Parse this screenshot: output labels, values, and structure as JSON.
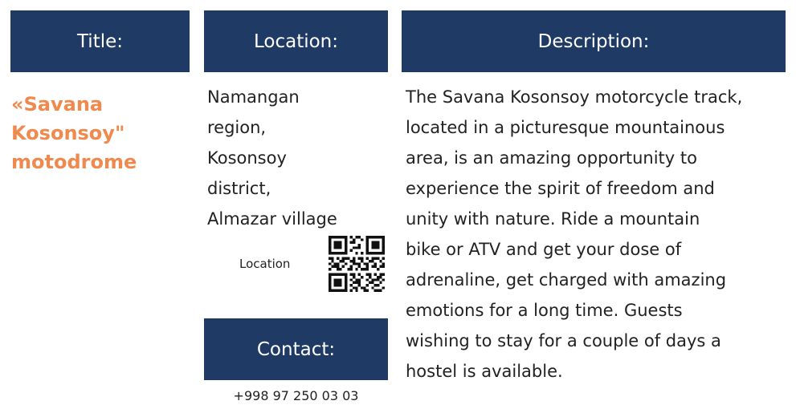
{
  "table": {
    "headers": {
      "title": "Title:",
      "location": "Location:",
      "description": "Description:"
    },
    "row": {
      "title_lines": [
        "«Savana",
        "Kosonsoy\"",
        "motodrome"
      ],
      "location_lines": [
        "Namangan",
        "region,",
        "Kosonsoy",
        "district,",
        "Almazar village"
      ],
      "location_qr_label": "Location",
      "description_lines": [
        "The Savana Kosonsoy motorcycle track,",
        "located in a picturesque mountainous",
        "area, is an amazing opportunity to",
        "experience the spirit of freedom and",
        "unity with nature. Ride a mountain",
        "bike or ATV and get your dose of",
        "adrenaline, get charged with amazing",
        "emotions for a long time. Guests",
        "wishing to stay for a couple of days a",
        "hostel is available."
      ],
      "contact_header": "Contact:",
      "phone": "+998 97 250 03 03"
    }
  },
  "colors": {
    "header_bg": "#1f3a64",
    "header_text": "#ffffff",
    "title_accent": "#f0894d",
    "body_text": "#222222"
  },
  "icons": {
    "qr": "qr-code-icon"
  }
}
